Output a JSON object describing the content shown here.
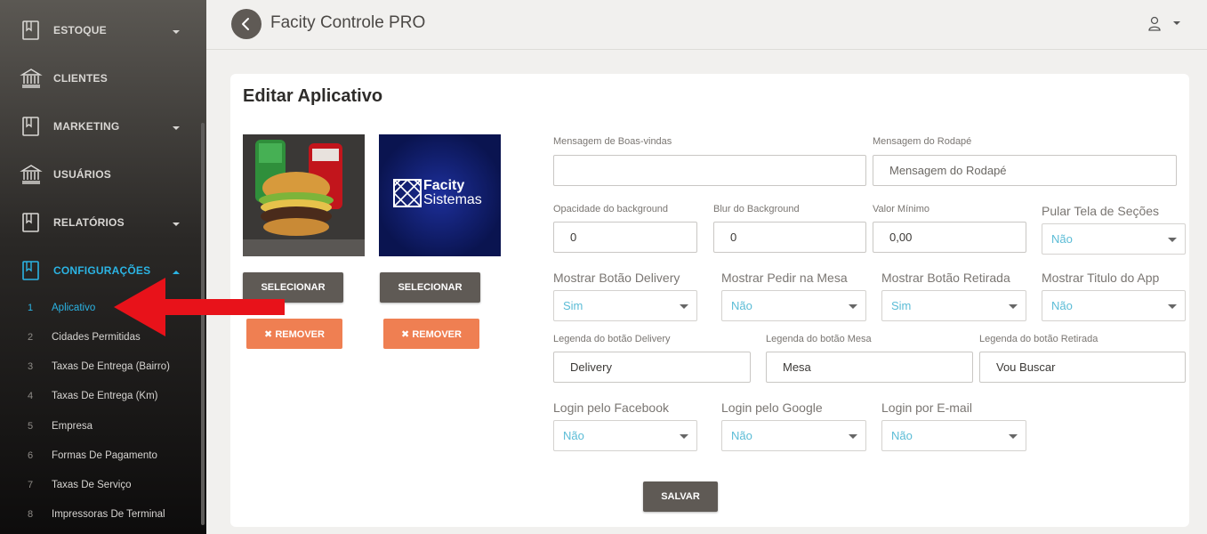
{
  "sidebar": {
    "menu": [
      {
        "label": "ESTOQUE",
        "icon": "book-icon",
        "caret": true
      },
      {
        "label": "CLIENTES",
        "icon": "bank-icon",
        "caret": false
      },
      {
        "label": "MARKETING",
        "icon": "book-icon",
        "caret": true
      },
      {
        "label": "USUÁRIOS",
        "icon": "bank-icon",
        "caret": false
      },
      {
        "label": "RELATÓRIOS",
        "icon": "book-icon",
        "caret": true
      },
      {
        "label": "CONFIGURAÇÕES",
        "icon": "book-icon",
        "caret": true,
        "active": true
      }
    ],
    "submenu": [
      {
        "num": "1",
        "label": "Aplicativo",
        "active": true
      },
      {
        "num": "2",
        "label": "Cidades Permitidas"
      },
      {
        "num": "3",
        "label": "Taxas De Entrega (Bairro)"
      },
      {
        "num": "4",
        "label": "Taxas De Entrega (Km)"
      },
      {
        "num": "5",
        "label": "Empresa"
      },
      {
        "num": "6",
        "label": "Formas De Pagamento"
      },
      {
        "num": "7",
        "label": "Taxas De Serviço"
      },
      {
        "num": "8",
        "label": "Impressoras De Terminal"
      }
    ]
  },
  "topbar": {
    "title": "Facity Controle PRO"
  },
  "card": {
    "title": "Editar Aplicativo",
    "logo_text": {
      "line1": "Facity",
      "line2": "Sistemas"
    },
    "select_label": "SELECIONAR",
    "remove_label": "✖ REMOVER",
    "save_label": "SALVAR"
  },
  "form": {
    "boas_vindas": {
      "label": "Mensagem de Boas-vindas",
      "value": ""
    },
    "rodape": {
      "label": "Mensagem do Rodapé",
      "placeholder": "Mensagem do Rodapé"
    },
    "opacidade": {
      "label": "Opacidade do background",
      "value": "0"
    },
    "blur": {
      "label": "Blur do Background",
      "value": "0"
    },
    "valor_minimo": {
      "label": "Valor Mínimo",
      "value": "0,00"
    },
    "pular_tela": {
      "label": "Pular Tela de Seções",
      "value": "Não"
    },
    "botao_delivery": {
      "label": "Mostrar Botão Delivery",
      "value": "Sim"
    },
    "pedir_mesa": {
      "label": "Mostrar Pedir na Mesa",
      "value": "Não"
    },
    "botao_retirada": {
      "label": "Mostrar Botão Retirada",
      "value": "Sim"
    },
    "titulo_app": {
      "label": "Mostrar Titulo do App",
      "value": "Não"
    },
    "legenda_delivery": {
      "label": "Legenda do botão Delivery",
      "value": "Delivery"
    },
    "legenda_mesa": {
      "label": "Legenda do botão Mesa",
      "value": "Mesa"
    },
    "legenda_retirada": {
      "label": "Legenda do botão Retirada",
      "value": "Vou Buscar"
    },
    "login_facebook": {
      "label": "Login pelo Facebook",
      "value": "Não"
    },
    "login_google": {
      "label": "Login pelo Google",
      "value": "Não"
    },
    "login_email": {
      "label": "Login por E-mail",
      "value": "Não"
    }
  },
  "colors": {
    "accent": "#2bb4e4",
    "dark_button": "#5f5a55",
    "orange_button": "#ef7f52",
    "arrow": "#e8121a",
    "select_text": "#5bbcd6"
  }
}
